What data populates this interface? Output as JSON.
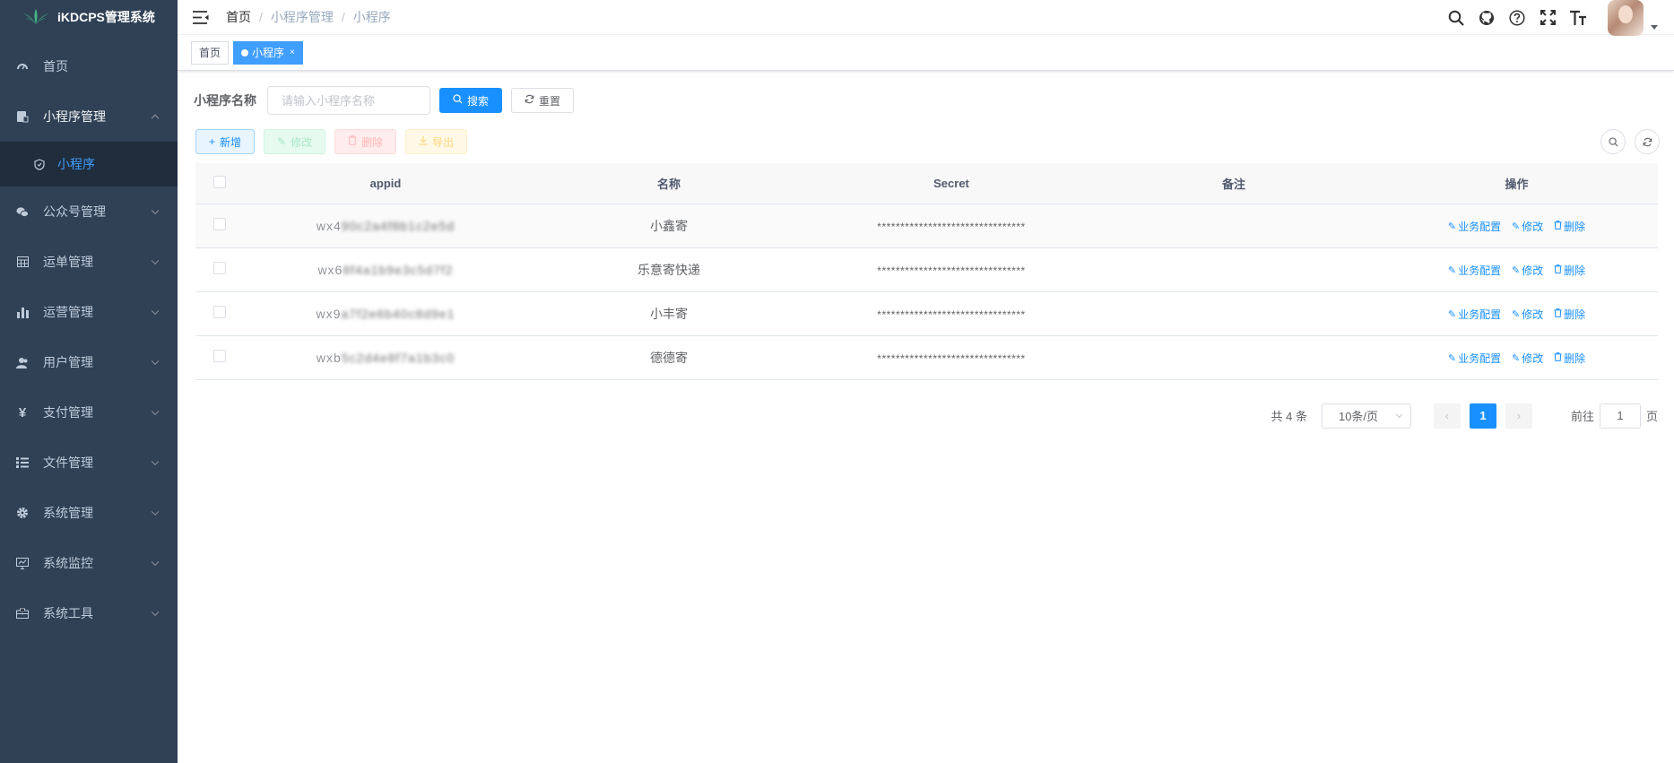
{
  "app": {
    "title": "iKDCPS管理系统"
  },
  "sidebar": {
    "items": [
      {
        "label": "首页",
        "icon": "dashboard-icon"
      },
      {
        "label": "小程序管理",
        "icon": "miniprogram-icon",
        "expanded": true,
        "children": [
          {
            "label": "小程序",
            "icon": "shield-icon",
            "active": true
          }
        ]
      },
      {
        "label": "公众号管理",
        "icon": "wechat-icon"
      },
      {
        "label": "运单管理",
        "icon": "table-icon"
      },
      {
        "label": "运营管理",
        "icon": "bar-chart-icon"
      },
      {
        "label": "用户管理",
        "icon": "users-icon"
      },
      {
        "label": "支付管理",
        "icon": "yen-icon"
      },
      {
        "label": "文件管理",
        "icon": "list-icon"
      },
      {
        "label": "系统管理",
        "icon": "gear-icon"
      },
      {
        "label": "系统监控",
        "icon": "monitor-icon"
      },
      {
        "label": "系统工具",
        "icon": "toolbox-icon"
      }
    ],
    "colors": {
      "bg": "#304156",
      "active_text": "#409eff",
      "submenu_bg": "#1f2d3d"
    }
  },
  "navbar": {
    "breadcrumb": [
      "首页",
      "小程序管理",
      "小程序"
    ],
    "separator": "/",
    "icons": [
      "search-icon",
      "github-icon",
      "question-icon",
      "fullscreen-icon",
      "font-size-icon"
    ]
  },
  "tags": [
    {
      "label": "首页",
      "active": false
    },
    {
      "label": "小程序",
      "active": true,
      "close": "×"
    }
  ],
  "search": {
    "label": "小程序名称",
    "placeholder": "请输入小程序名称",
    "search_label": "搜索",
    "reset_label": "重置"
  },
  "toolbar": {
    "add_label": "新增",
    "edit_label": "修改",
    "delete_label": "删除",
    "export_label": "导出"
  },
  "table": {
    "headers": [
      "appid",
      "名称",
      "Secret",
      "备注",
      "操作"
    ],
    "rows": [
      {
        "appid_prefix": "wx4",
        "appid_blur": "90c2a4f8b1c2e5d",
        "name": "小鑫寄",
        "secret": "********************************",
        "remark": ""
      },
      {
        "appid_prefix": "wx6",
        "appid_blur": "8f4a1b9e3c5d7f2",
        "name": "乐意寄快递",
        "secret": "********************************",
        "remark": ""
      },
      {
        "appid_prefix": "wx9",
        "appid_blur": "a7f2e6b40c8d9e1",
        "name": "小丰寄",
        "secret": "********************************",
        "remark": ""
      },
      {
        "appid_prefix": "wxb",
        "appid_blur": "5c2d4e8f7a1b3c0",
        "name": "德德寄",
        "secret": "********************************",
        "remark": ""
      }
    ],
    "ops": {
      "config": "业务配置",
      "edit": "修改",
      "delete": "删除"
    }
  },
  "pagination": {
    "total_text": "共 4 条",
    "page_size": "10条/页",
    "current_page": "1",
    "goto_label": "前往",
    "goto_value": "1",
    "page_suffix": "页"
  },
  "colors": {
    "primary": "#1890ff"
  }
}
